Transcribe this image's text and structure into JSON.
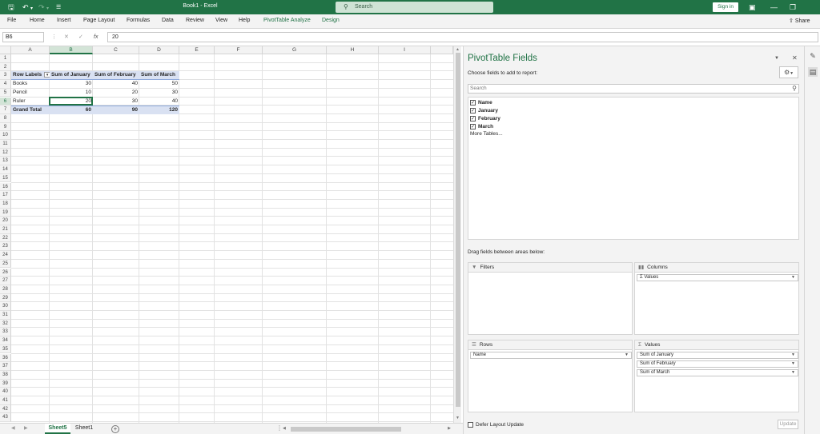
{
  "titlebar": {
    "doc_title": "Book1  -  Excel",
    "search_placeholder": "Search",
    "signin_label": "Sign in"
  },
  "ribbon": {
    "tabs": [
      "File",
      "Home",
      "Insert",
      "Page Layout",
      "Formulas",
      "Data",
      "Review",
      "View",
      "Help",
      "PivotTable Analyze",
      "Design"
    ],
    "share_label": "Share"
  },
  "formula_bar": {
    "name_box": "B6",
    "fx_label": "fx",
    "value": "20"
  },
  "grid": {
    "columns": [
      "A",
      "B",
      "C",
      "D",
      "E",
      "F",
      "G",
      "H",
      "I"
    ],
    "selected_column": "B",
    "rows": [
      "1",
      "2",
      "3",
      "4",
      "5",
      "6",
      "7",
      "8",
      "9",
      "10",
      "11",
      "12",
      "13",
      "14",
      "15",
      "16",
      "17",
      "18",
      "19",
      "20",
      "21",
      "22",
      "23",
      "24",
      "25",
      "26",
      "27",
      "28",
      "29",
      "30",
      "31",
      "32",
      "33",
      "34",
      "35",
      "36",
      "37",
      "38",
      "39",
      "40",
      "41",
      "42",
      "43"
    ],
    "selected_row": "6",
    "active_cell": "B6"
  },
  "pivot_table": {
    "headers": [
      "Row Labels",
      "Sum of January",
      "Sum of February",
      "Sum of March"
    ],
    "rows": [
      {
        "label": "Books",
        "jan": "30",
        "feb": "40",
        "mar": "50"
      },
      {
        "label": "Pencil",
        "jan": "10",
        "feb": "20",
        "mar": "30"
      },
      {
        "label": "Ruler",
        "jan": "20",
        "feb": "30",
        "mar": "40"
      }
    ],
    "total": {
      "label": "Grand Total",
      "jan": "60",
      "feb": "90",
      "mar": "120"
    }
  },
  "sheets": {
    "tabs": [
      "Sheet5",
      "Sheet1"
    ],
    "active": "Sheet5"
  },
  "pivot_pane": {
    "title": "PivotTable Fields",
    "subtitle": "Choose fields to add to report:",
    "search_placeholder": "Search",
    "fields": [
      {
        "name": "Name",
        "checked": true
      },
      {
        "name": "January",
        "checked": true
      },
      {
        "name": "February",
        "checked": true
      },
      {
        "name": "March",
        "checked": true
      }
    ],
    "more_tables": "More Tables...",
    "drag_label": "Drag fields between areas below:",
    "areas": {
      "filters": {
        "title": "Filters",
        "items": []
      },
      "columns": {
        "title": "Columns",
        "items": [
          "Values"
        ]
      },
      "rows": {
        "title": "Rows",
        "items": [
          "Name"
        ]
      },
      "values": {
        "title": "Values",
        "items": [
          "Sum of January",
          "Sum of February",
          "Sum of March"
        ]
      }
    },
    "defer_label": "Defer Layout Update",
    "update_label": "Update"
  },
  "colors": {
    "excel_green": "#217346",
    "pivot_header_fill": "#d9e1f2"
  },
  "icons": [
    "save-icon",
    "undo-icon",
    "redo-icon",
    "customize-icon",
    "search-icon",
    "ribbon-display-icon",
    "minimize-icon",
    "restore-icon",
    "share-icon",
    "gear-icon",
    "close-icon",
    "chevron-down-icon",
    "sigma-icon",
    "filter-icon",
    "columns-icon",
    "rows-icon",
    "pivot-fields-icon",
    "format-icon"
  ]
}
